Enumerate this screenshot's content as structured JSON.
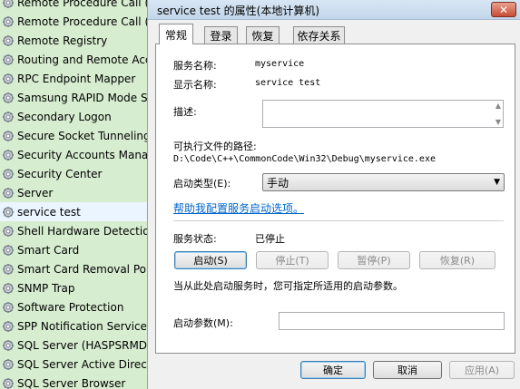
{
  "services": [
    {
      "name": "Remote Procedure Call (",
      "selected": false
    },
    {
      "name": "Remote Procedure Call (",
      "selected": false
    },
    {
      "name": "Remote Registry",
      "selected": false
    },
    {
      "name": "Routing and Remote Acc",
      "selected": false
    },
    {
      "name": "RPC Endpoint Mapper",
      "selected": false
    },
    {
      "name": "Samsung RAPID Mode S",
      "selected": false
    },
    {
      "name": "Secondary Logon",
      "selected": false
    },
    {
      "name": "Secure Socket Tunneling",
      "selected": false
    },
    {
      "name": "Security Accounts Manag",
      "selected": false
    },
    {
      "name": "Security Center",
      "selected": false
    },
    {
      "name": "Server",
      "selected": false
    },
    {
      "name": "service test",
      "selected": true
    },
    {
      "name": "Shell Hardware Detection",
      "selected": false
    },
    {
      "name": "Smart Card",
      "selected": false
    },
    {
      "name": "Smart Card Removal Pol",
      "selected": false
    },
    {
      "name": "SNMP Trap",
      "selected": false
    },
    {
      "name": "Software Protection",
      "selected": false
    },
    {
      "name": "SPP Notification Service",
      "selected": false
    },
    {
      "name": "SQL Server (HASPSRMDA",
      "selected": false
    },
    {
      "name": "SQL Server Active Directo",
      "selected": false
    },
    {
      "name": "SQL Server Browser",
      "selected": false
    }
  ],
  "dialog": {
    "title": "service test 的属性(本地计算机)",
    "close_glyph": "✕",
    "tabs": [
      "常规",
      "登录",
      "恢复",
      "依存关系"
    ],
    "service_name_label": "服务名称:",
    "service_name_value": "myservice",
    "display_name_label": "显示名称:",
    "display_name_value": "service test",
    "description_label": "描述:",
    "description_value": "",
    "exe_path_label": "可执行文件的路径:",
    "exe_path_value": "D:\\Code\\C++\\CommonCode\\Win32\\Debug\\myservice.exe",
    "startup_type_label": "启动类型(E):",
    "startup_type_value": "手动",
    "help_link": "帮助我配置服务启动选项。",
    "status_label": "服务状态:",
    "status_value": "已停止",
    "start_button": "启动(S)",
    "stop_button": "停止(T)",
    "pause_button": "暂停(P)",
    "resume_button": "恢复(R)",
    "start_hint": "当从此处启动服务时，您可指定所适用的启动参数。",
    "start_params_label": "启动参数(M):",
    "start_params_value": "",
    "ok_button": "确定",
    "cancel_button": "取消",
    "apply_button": "应用(A)"
  },
  "colors": {
    "list_bg": "#d7edd0",
    "selected_row": "#eaf5ff",
    "link": "#0066cc",
    "close_red": "#c74d35"
  }
}
